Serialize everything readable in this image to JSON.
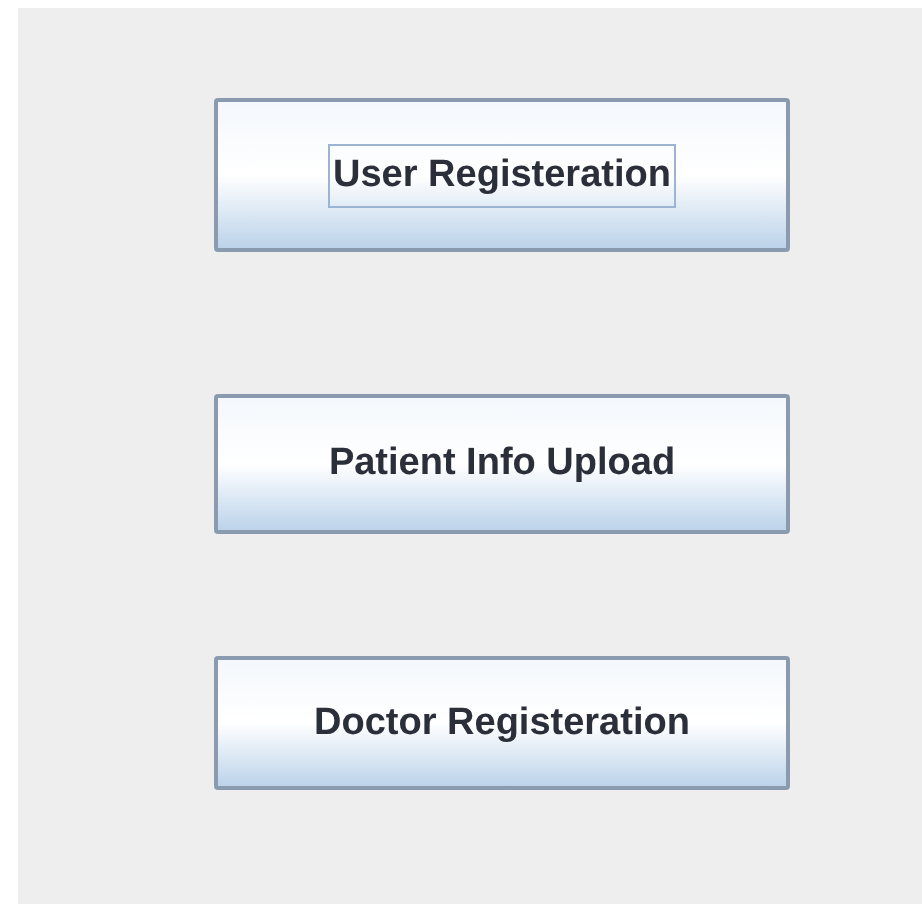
{
  "buttons": [
    {
      "label": "User Registeration",
      "focused": true
    },
    {
      "label": "Patient Info Upload",
      "focused": false
    },
    {
      "label": "Doctor Registeration",
      "focused": false
    }
  ]
}
